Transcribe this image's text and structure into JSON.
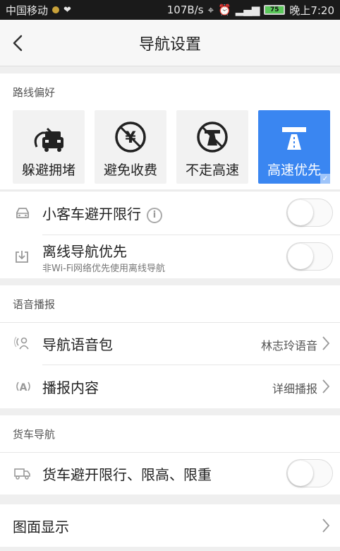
{
  "statusbar": {
    "carrier": "中国移动",
    "speed": "107B/s",
    "battery": "75",
    "time": "晚上7:20"
  },
  "header": {
    "title": "导航设置"
  },
  "route_pref": {
    "section_label": "路线偏好",
    "options": [
      {
        "label": "躲避拥堵",
        "active": false
      },
      {
        "label": "避免收费",
        "active": false
      },
      {
        "label": "不走高速",
        "active": false
      },
      {
        "label": "高速优先",
        "active": true
      }
    ],
    "car_limit": {
      "label": "小客车避开限行",
      "info": "i"
    },
    "offline": {
      "label": "离线导航优先",
      "sub": "非Wi-Fi网络优先使用离线导航"
    }
  },
  "voice": {
    "section_label": "语音播报",
    "voice_pack": {
      "label": "导航语音包",
      "value": "林志玲语音"
    },
    "broadcast": {
      "label": "播报内容",
      "value": "详细播报"
    }
  },
  "truck": {
    "section_label": "货车导航",
    "truck_limit": {
      "label": "货车避开限行、限高、限重"
    }
  },
  "display": {
    "label": "图面显示"
  }
}
